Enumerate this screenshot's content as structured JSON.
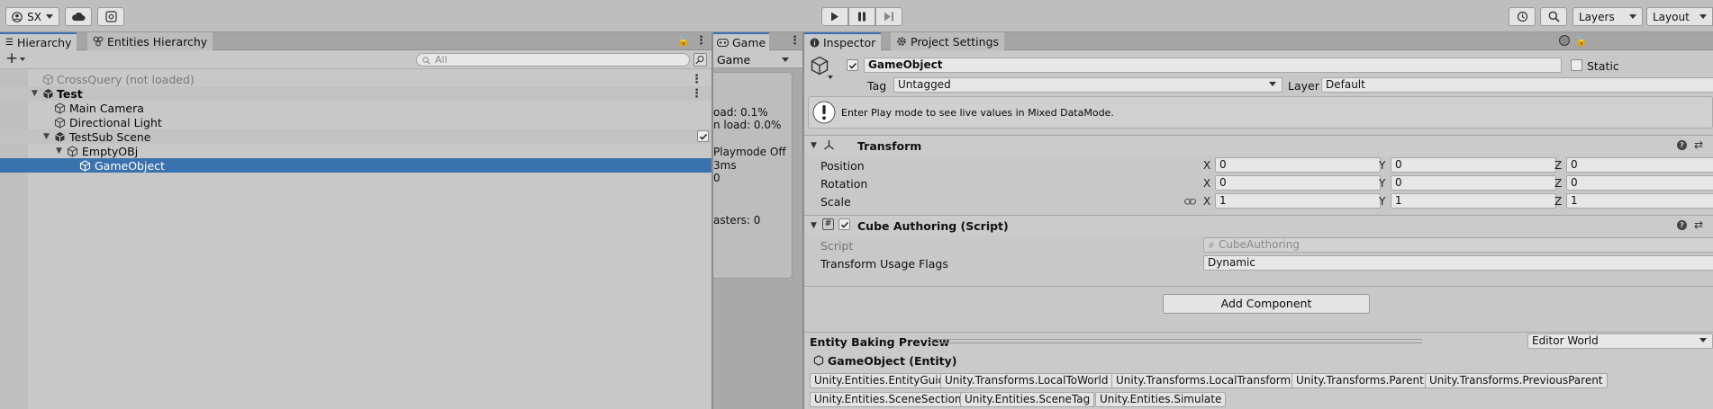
{
  "toolbar": {
    "account_label": "SX",
    "layers_label": "Layers",
    "layout_label": "Layout"
  },
  "hierarchy": {
    "tab_label": "Hierarchy",
    "entities_tab_label": "Entities Hierarchy",
    "search_placeholder": "All",
    "rows": [
      {
        "label": "CrossQuery (not loaded)",
        "indent": 0
      },
      {
        "label": "Test",
        "indent": 0
      },
      {
        "label": "Main Camera",
        "indent": 1
      },
      {
        "label": "Directional Light",
        "indent": 1
      },
      {
        "label": "TestSub Scene",
        "indent": 1
      },
      {
        "label": "EmptyOBj",
        "indent": 2
      },
      {
        "label": "GameObject",
        "indent": 3
      }
    ]
  },
  "game": {
    "tab_label": "Game",
    "view_dropdown": "Game",
    "stats": [
      "oad: 0.1%",
      "n load: 0.0%",
      "Playmode Off",
      "3ms",
      "0",
      "asters: 0"
    ]
  },
  "inspector": {
    "tab_label": "Inspector",
    "project_settings_tab_label": "Project Settings",
    "object_name": "GameObject",
    "static_label": "Static",
    "tag_label": "Tag",
    "tag_value": "Untagged",
    "layer_label": "Layer",
    "layer_value": "Default",
    "info_message": "Enter Play mode to see live values in Mixed DataMode.",
    "transform": {
      "title": "Transform",
      "rows": [
        {
          "label": "Position",
          "x": "0",
          "y": "0",
          "z": "0"
        },
        {
          "label": "Rotation",
          "x": "0",
          "y": "0",
          "z": "0"
        },
        {
          "label": "Scale",
          "x": "1",
          "y": "1",
          "z": "1"
        }
      ],
      "axis_x": "X",
      "axis_y": "Y",
      "axis_z": "Z"
    },
    "cube_authoring": {
      "title": "Cube Authoring (Script)",
      "script_label": "Script",
      "script_value": "CubeAuthoring",
      "flags_label": "Transform Usage Flags",
      "flags_value": "Dynamic"
    },
    "add_component_label": "Add Component",
    "baking": {
      "title": "Entity Baking Preview",
      "world_value": "Editor World",
      "entity_label": "GameObject (Entity)",
      "components": [
        "Unity.Entities.EntityGuid",
        "Unity.Transforms.LocalToWorld",
        "Unity.Transforms.LocalTransform",
        "Unity.Transforms.Parent",
        "Unity.Transforms.PreviousParent",
        "Unity.Entities.SceneSection",
        "Unity.Entities.SceneTag",
        "Unity.Entities.Simulate"
      ]
    }
  },
  "colors": {
    "selection": "#3a72b0",
    "panel_bg": "#c8c8c8",
    "tab_bar": "#a5a5a5"
  }
}
